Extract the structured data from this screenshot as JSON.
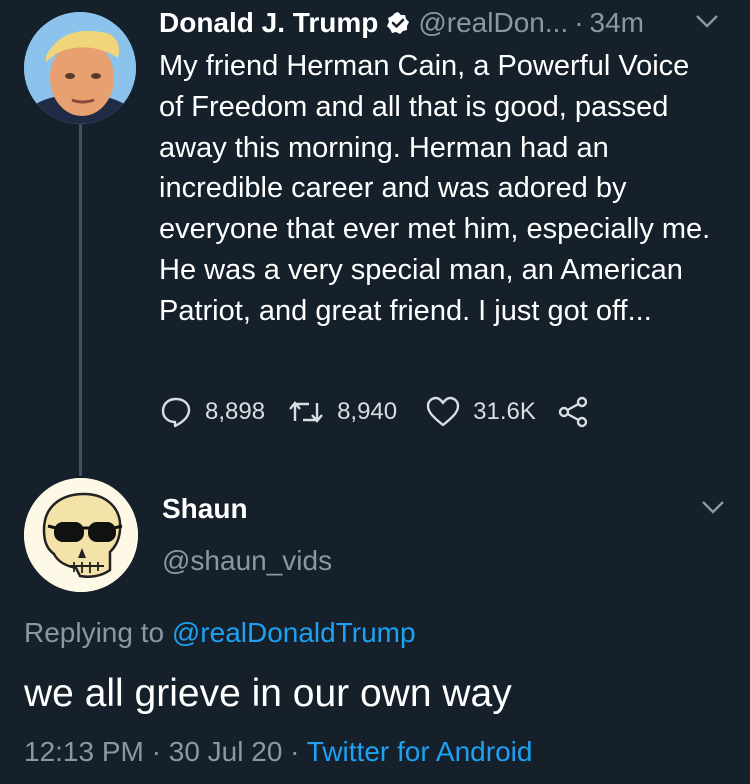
{
  "tweet": {
    "author_name": "Donald J. Trump",
    "handle": "@realDon...",
    "separator": "·",
    "time": "34m",
    "body": "My friend Herman Cain, a Powerful Voice of Freedom and all that is good, passed away this morning. Herman had an incredible career and was adored by everyone that ever met him, especially me. He was a very special man, an American Patriot, and great friend. I just got off...",
    "replies": "8,898",
    "retweets": "8,940",
    "likes": "31.6K",
    "icons": [
      "verified-badge-icon",
      "chevron-down-icon",
      "reply-icon",
      "retweet-icon",
      "like-icon",
      "share-icon"
    ]
  },
  "reply": {
    "author_name": "Shaun",
    "handle": "@shaun_vids",
    "replying_prefix": "Replying to ",
    "replying_to": "@realDonaldTrump",
    "text": "we all grieve in our own way",
    "time": "12:13 PM",
    "sep1": " · ",
    "date": "30 Jul 20",
    "sep2": " · ",
    "source": "Twitter for Android"
  },
  "colors": {
    "background": "#15202b",
    "secondary_text": "#8899a6",
    "accent": "#1da1f2",
    "thread_line": "#3d5466"
  }
}
